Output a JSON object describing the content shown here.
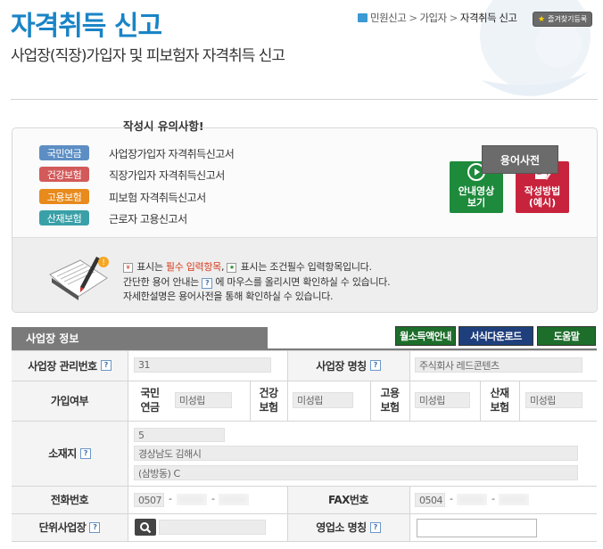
{
  "page": {
    "title": "자격취득 신고",
    "subtitle": "사업장(직장)가입자 및 피보험자 자격취득 신고",
    "breadcrumb": [
      "민원신고",
      "가입자",
      "자격취득 신고"
    ],
    "favorite_label": "즐겨찾기등록"
  },
  "forms": [
    {
      "badge": "국민연금",
      "color": "#5c8ec4",
      "label": "사업장가입자 자격취득신고서"
    },
    {
      "badge": "건강보험",
      "color": "#d35a5a",
      "label": "직장가입자 자격취득신고서"
    },
    {
      "badge": "고용보험",
      "color": "#e88a1c",
      "label": "피보험 자격취득신고서"
    },
    {
      "badge": "산재보험",
      "color": "#3aa0a8",
      "label": "근로자 고용신고서"
    }
  ],
  "actions": {
    "video_label": "안내영상\n보기",
    "example_label": "작성방법\n(예시)",
    "video_color": "#1e8a3c",
    "example_color": "#c8233c"
  },
  "notice": {
    "title": "작성시 유의사항!",
    "line1_prefix": "표시는 ",
    "line1_required": "필수 입력항목",
    "line1_middle": ", ",
    "line1_suffix": " 표시는 조건필수 입력항목입니다.",
    "line2_prefix": "간단한 용어 안내는 ",
    "line2_suffix": " 에 마우스를 올리시면 확인하실 수 있습니다.",
    "line3": "자세한설명은 용어사전을 통해 확인하실 수 있습니다.",
    "dictionary_button": "용어사전"
  },
  "section": {
    "title": "사업장 정보",
    "buttons": {
      "monthly_income": "월소득액안내",
      "form_download": "서식다운로드",
      "help": "도움말"
    }
  },
  "table": {
    "mgmt_no_label": "사업장 관리번호",
    "mgmt_no_value": "31",
    "workplace_name_label": "사업장 명칭",
    "workplace_name_value": "주식회사 레드콘텐츠",
    "join_label": "가입여부",
    "insurances": [
      {
        "label": "국민\n연금",
        "value": "미성립"
      },
      {
        "label": "건강\n보험",
        "value": "미성립"
      },
      {
        "label": "고용\n보험",
        "value": "미성립"
      },
      {
        "label": "산재\n보험",
        "value": "미성립"
      }
    ],
    "address_label": "소재지",
    "address_zip": "5",
    "address_line1": "경상남도 김해시",
    "address_line2": "(삼방동) C",
    "phone_label": "전화번호",
    "phone_prefix": "0507",
    "fax_label": "FAX번호",
    "fax_prefix": "0504",
    "unit_label": "단위사업장",
    "business_name_label": "영업소 명칭"
  }
}
